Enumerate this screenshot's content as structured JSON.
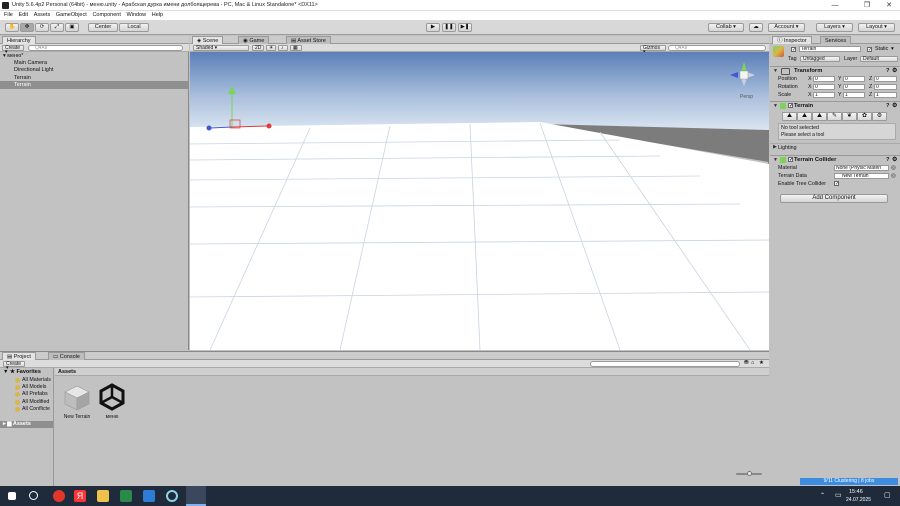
{
  "window": {
    "title": "Unity 5.6.4p2 Personal (64bit) - меню.unity - Арабская дурка имени долбоящерева - PC, Mac & Linux Standalone* <DX11>",
    "minimize": "—",
    "maximize": "❐",
    "close": "✕"
  },
  "menu": [
    "File",
    "Edit",
    "Assets",
    "GameObject",
    "Component",
    "Window",
    "Help"
  ],
  "toolbar": {
    "pivot": "Center",
    "space": "Local",
    "collab": "Collab ▾",
    "account": "Account",
    "layers": "Layers",
    "layout": "Layout"
  },
  "hierarchy": {
    "tab": "Hierarchy",
    "create": "Create ▾",
    "search_placeholder": "Q▾All",
    "scene_name": "▾ меню*",
    "items": [
      "Main Camera",
      "Directional Light",
      "Terrain",
      "Terrain"
    ],
    "selected_index": 3
  },
  "scene_view": {
    "tabs": [
      "Scene",
      "Game",
      "Asset Store"
    ],
    "active_tab": "Scene",
    "shading": "Shaded",
    "mode_2d": "2D",
    "gizmos": "Gizmos ▾",
    "search_placeholder": "Q▾All",
    "persp": "Persp"
  },
  "inspector": {
    "tabs": [
      "Inspector",
      "Services"
    ],
    "object_name": "Terrain",
    "static_label": "Static",
    "tag_label": "Tag",
    "tag_value": "Untagged",
    "layer_label": "Layer",
    "layer_value": "Default",
    "transform": {
      "title": "Transform",
      "rows": [
        {
          "label": "Position",
          "x": "0",
          "y": "0",
          "z": "0"
        },
        {
          "label": "Rotation",
          "x": "0",
          "y": "0",
          "z": "0"
        },
        {
          "label": "Scale",
          "x": "1",
          "y": "1",
          "z": "1"
        }
      ]
    },
    "terrain": {
      "title": "Terrain",
      "tools": [
        "⛰",
        "⛰",
        "⛰",
        "✎",
        "❦",
        "✿",
        "⚙"
      ],
      "no_tool": "No tool selected",
      "hint": "Please select a tool",
      "lighting": "Lighting"
    },
    "collider": {
      "title": "Terrain Collider",
      "material_label": "Material",
      "material_value": "None (Physic Materi",
      "data_label": "Terrain Data",
      "data_value": "New Terrain",
      "trees_label": "Enable Tree Collider"
    },
    "add_component": "Add Component",
    "status": "9/11 Clustering | 8 jobs"
  },
  "project": {
    "tabs": [
      "Project",
      "Console"
    ],
    "create": "Create ▾",
    "favorites_label": "Favorites",
    "favorites": [
      "All Materials",
      "All Models",
      "All Prefabs",
      "All Modified",
      "All Conflicte"
    ],
    "assets_root": "Assets",
    "breadcrumb": "Assets",
    "files": [
      {
        "name": "New Terrain",
        "icon": "terrain-asset-icon"
      },
      {
        "name": "меню",
        "icon": "unity-scene-icon"
      }
    ]
  },
  "taskbar": {
    "time": "15:46",
    "date": "24.07.2025",
    "apps": [
      "windows-logo-icon",
      "search-icon",
      "yandex-browser-icon",
      "yandex-icon",
      "file-explorer-icon",
      "media-player-icon",
      "store-icon",
      "refresh-app-icon",
      "unity-taskbar-icon"
    ]
  },
  "colors": {
    "selection": "#8f8f8f",
    "sky_top": "#5b7fb8",
    "sky_horizon": "#dde7f2",
    "ground": "#ffffff",
    "progress": "#3c8ce0",
    "taskbar": "#1f2a3b"
  }
}
